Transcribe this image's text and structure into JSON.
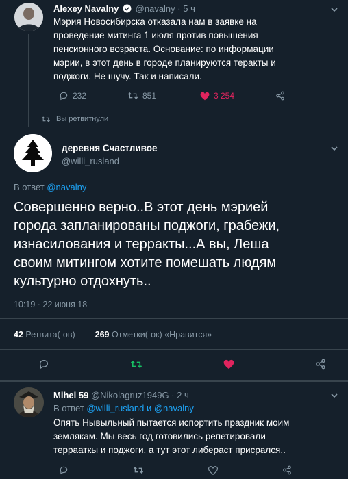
{
  "tweet1": {
    "name": "Alexey Navalny",
    "handle": "@navalny",
    "time": "· 5 ч",
    "lines": [
      "Мэрия Новосибирска отказала нам в заявке на",
      "проведение митинга 1 июля против повышения",
      "пенсионного возраста. Основание: по информации",
      "мэрии, в этот день в городе планируются теракты и",
      "поджоги. Не шучу. Так и написали."
    ],
    "replies": "232",
    "retweets": "851",
    "likes": "3 254"
  },
  "retweeted_notice": "Вы ретвитнули",
  "main": {
    "name": "деревня Счастливое",
    "handle": "@willi_rusland",
    "reply_prefix": "В ответ",
    "reply_to": "@navalny",
    "lines": [
      "Совершенно верно..В этот день мэрией",
      "города запланированы поджоги, грабежи,",
      "изнасилования и терракты...А вы, Леша",
      "своим митингом хотите помешать людям",
      "культурно отдохнуть.."
    ],
    "timestamp": "10:19 · 22 июня 18",
    "retweets_count": "42",
    "retweets_label": "Ретвита(-ов)",
    "likes_count": "269",
    "likes_label": "Отметки(-ок) «Нравится»"
  },
  "reply": {
    "name": "Mihel 59",
    "handle": "@Nikolagruz1949G",
    "time": "· 2 ч",
    "reply_prefix": "В ответ",
    "reply_to1": "@willi_rusland",
    "reply_and": "и",
    "reply_to2": "@navalny",
    "lines": [
      "Опять Нывыльный пытается испортить праздник моим",
      "землякам. Мы весь год готовились репетировали",
      "террааткы и поджоги, а тут этот либераст присрался.."
    ]
  },
  "colors": {
    "background": "#15202b",
    "accent": "#1da1f2",
    "like": "#e0245e",
    "retweet": "#17bf63",
    "muted": "#8899a6"
  }
}
